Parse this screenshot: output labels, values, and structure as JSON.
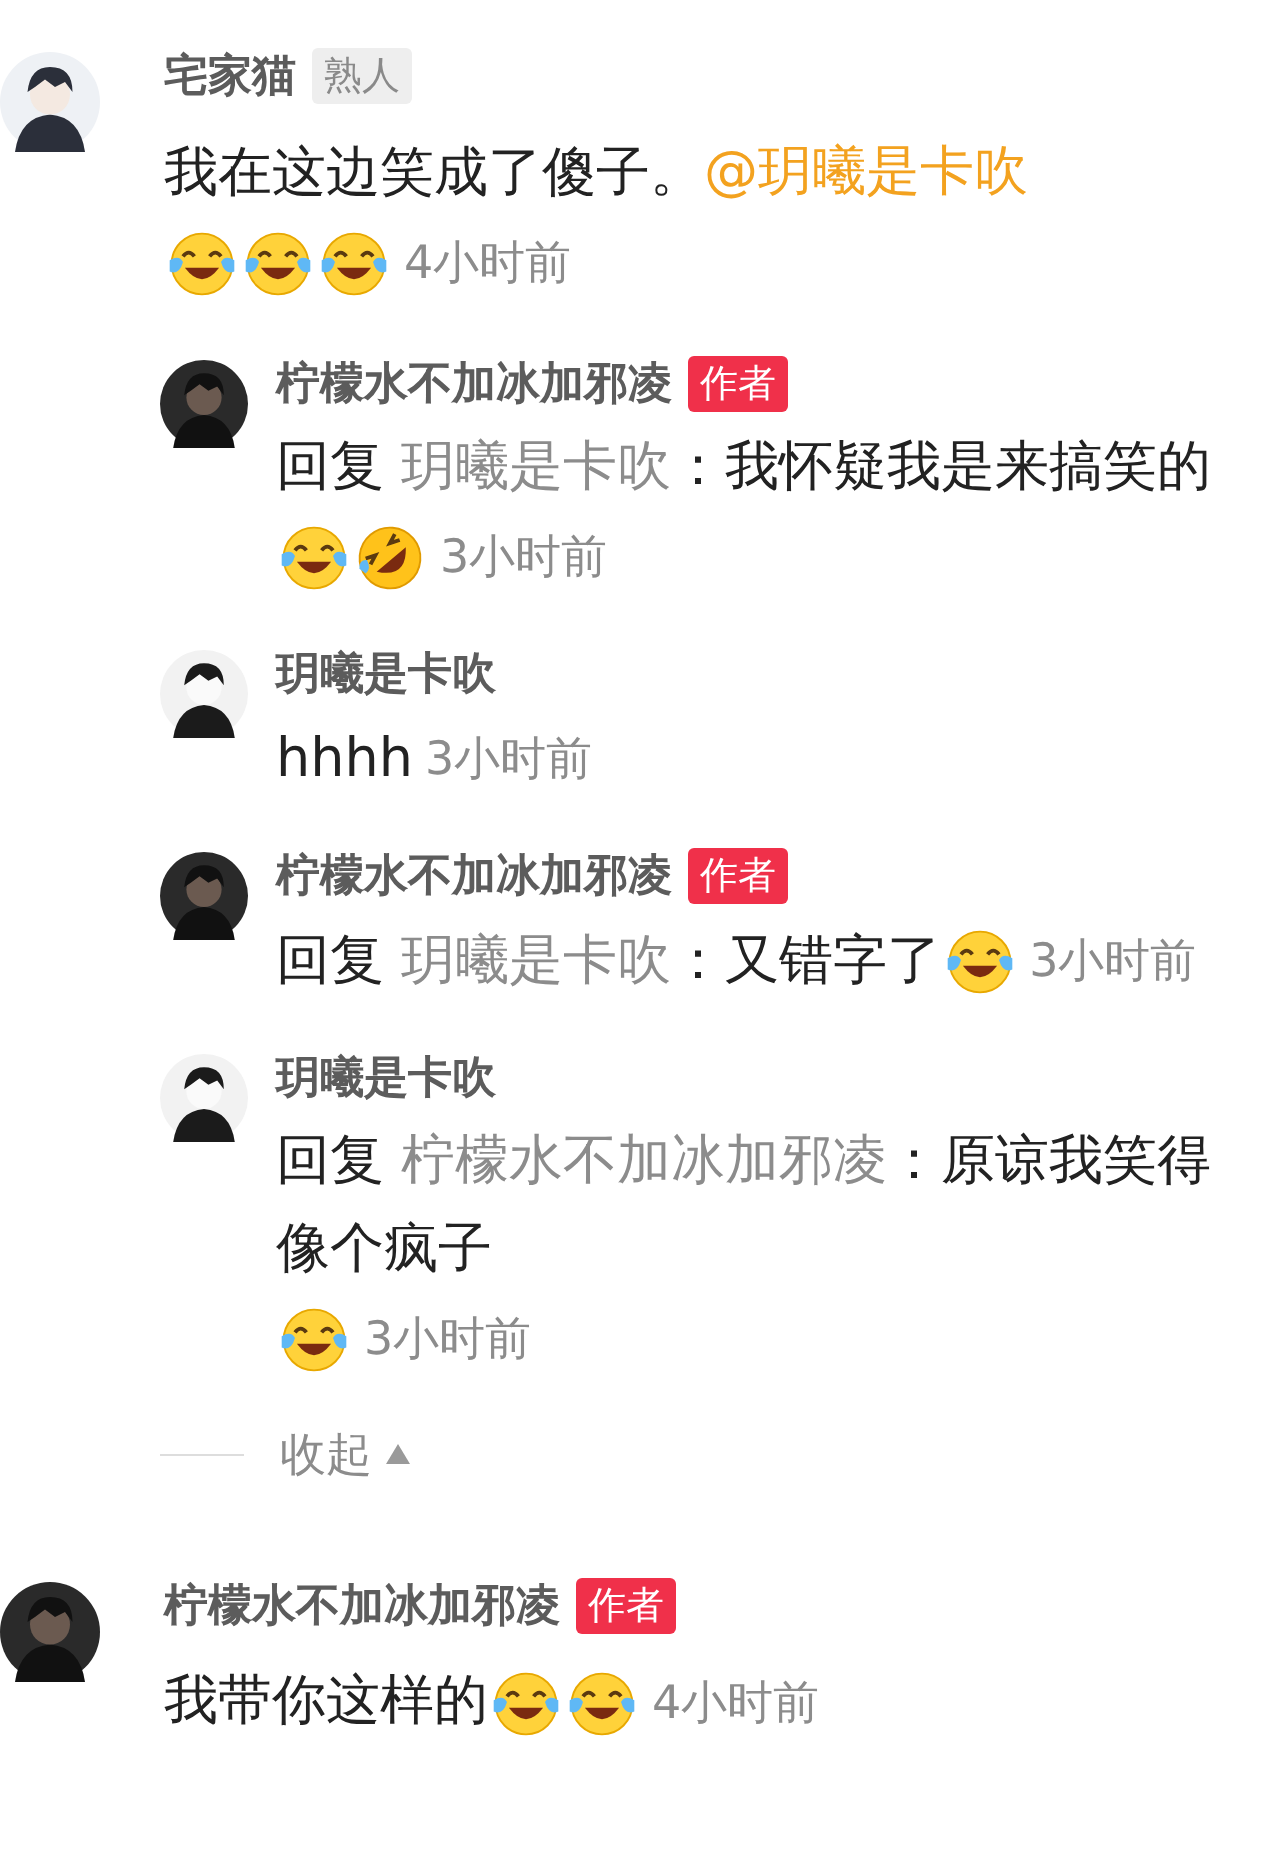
{
  "comments": [
    {
      "user": "宅家猫",
      "avatar": {
        "kind": "light"
      },
      "badge": {
        "kind": "friend",
        "label": "熟人"
      },
      "text": "我在这边笑成了傻子。",
      "mention": "@玥曦是卡吹",
      "emojis": [
        {
          "kind": "tears"
        },
        {
          "kind": "tears"
        },
        {
          "kind": "tears"
        }
      ],
      "time": "4小时前",
      "replies": [
        {
          "user": "柠檬水不加冰加邪凌",
          "avatar": {
            "kind": "dark"
          },
          "badge": {
            "kind": "author",
            "label": "作者"
          },
          "reply_prefix": "回复",
          "reply_to": "玥曦是卡吹",
          "text": "：我怀疑我是来搞笑的",
          "emojis": [
            {
              "kind": "tears"
            },
            {
              "kind": "rofl"
            }
          ],
          "time": "3小时前"
        },
        {
          "user": "玥曦是卡吹",
          "avatar": {
            "kind": "sketch"
          },
          "text": "hhhh",
          "time": "3小时前"
        },
        {
          "user": "柠檬水不加冰加邪凌",
          "avatar": {
            "kind": "dark"
          },
          "badge": {
            "kind": "author",
            "label": "作者"
          },
          "reply_prefix": "回复",
          "reply_to": "玥曦是卡吹",
          "text": "：又错字了",
          "emojis": [
            {
              "kind": "tears"
            }
          ],
          "time": "3小时前"
        },
        {
          "user": "玥曦是卡吹",
          "avatar": {
            "kind": "sketch"
          },
          "reply_prefix": "回复",
          "reply_to": "柠檬水不加冰加邪凌",
          "text": "：原谅我笑得像个疯子",
          "emojis": [
            {
              "kind": "tears"
            }
          ],
          "time": "3小时前"
        }
      ],
      "collapse": {
        "label": "收起",
        "expanded": true
      }
    },
    {
      "user": "柠檬水不加冰加邪凌",
      "avatar": {
        "kind": "dark"
      },
      "badge": {
        "kind": "author",
        "label": "作者"
      },
      "text": "我带你这样的",
      "emojis": [
        {
          "kind": "tears"
        },
        {
          "kind": "tears"
        }
      ],
      "time": "4小时前"
    }
  ]
}
